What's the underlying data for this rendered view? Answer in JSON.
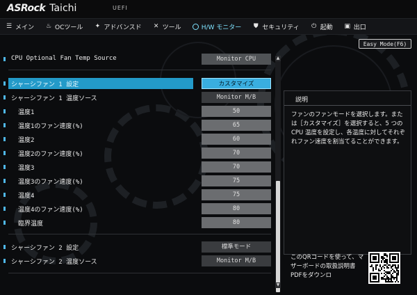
{
  "header": {
    "brand": "ASRock",
    "model": "Taichi",
    "firmware": "UEFI"
  },
  "nav": [
    {
      "label": "メイン",
      "icon": "list-icon",
      "glyph": "☰"
    },
    {
      "label": "OCツール",
      "icon": "flame-icon",
      "glyph": "♨"
    },
    {
      "label": "アドバンスド",
      "icon": "star-icon",
      "glyph": "✦"
    },
    {
      "label": "ツール",
      "icon": "wrench-icon",
      "glyph": "✕"
    },
    {
      "label": "H/W モニター",
      "icon": "monitor-icon",
      "glyph": ""
    },
    {
      "label": "セキュリティ",
      "icon": "shield-icon",
      "glyph": "⛊"
    },
    {
      "label": "起動",
      "icon": "power-icon",
      "glyph": "⏻"
    },
    {
      "label": "出口",
      "icon": "exit-icon",
      "glyph": "▣"
    }
  ],
  "easy_mode": "Easy Mode(F6)",
  "rows": [
    {
      "label": "CPU Optional Fan Temp Source",
      "value": "Monitor CPU",
      "sub": false
    },
    {
      "label": "シャーシファン 1 設定",
      "value": "カスタマイズ",
      "sub": false,
      "selected": true
    },
    {
      "label": "シャーシファン 1 温度ソース",
      "value": "Monitor M/B",
      "sub": false
    },
    {
      "label": "温度1",
      "value": "50",
      "sub": true
    },
    {
      "label": "温度1のファン速度(%)",
      "value": "65",
      "sub": true
    },
    {
      "label": "温度2",
      "value": "60",
      "sub": true
    },
    {
      "label": "温度2のファン速度(%)",
      "value": "70",
      "sub": true
    },
    {
      "label": "温度3",
      "value": "70",
      "sub": true
    },
    {
      "label": "温度3のファン速度(%)",
      "value": "75",
      "sub": true
    },
    {
      "label": "温度4",
      "value": "75",
      "sub": true
    },
    {
      "label": "温度4のファン速度(%)",
      "value": "80",
      "sub": true
    },
    {
      "label": "臨界温度",
      "value": "80",
      "sub": true
    },
    {
      "label": "シャーシファン 2 設定",
      "value": "標準モード",
      "sub": false
    },
    {
      "label": "シャーシファン 2 温度ソース",
      "value": "Monitor M/B",
      "sub": false
    }
  ],
  "description": {
    "title": "説明",
    "text": "ファンのファンモードを選択します。または［カスタマイズ］を選択すると、5 つの CPU 温度を設定し、各温度に対してそれぞれファン速度を割当てることができます。"
  },
  "qr_text": "このQRコードを使って、マザーボードの取扱説明書PDFをダウンロ",
  "colors": {
    "accent": "#239ac9",
    "value_box": "#505356",
    "highlight_text": "#7fe3ff"
  }
}
